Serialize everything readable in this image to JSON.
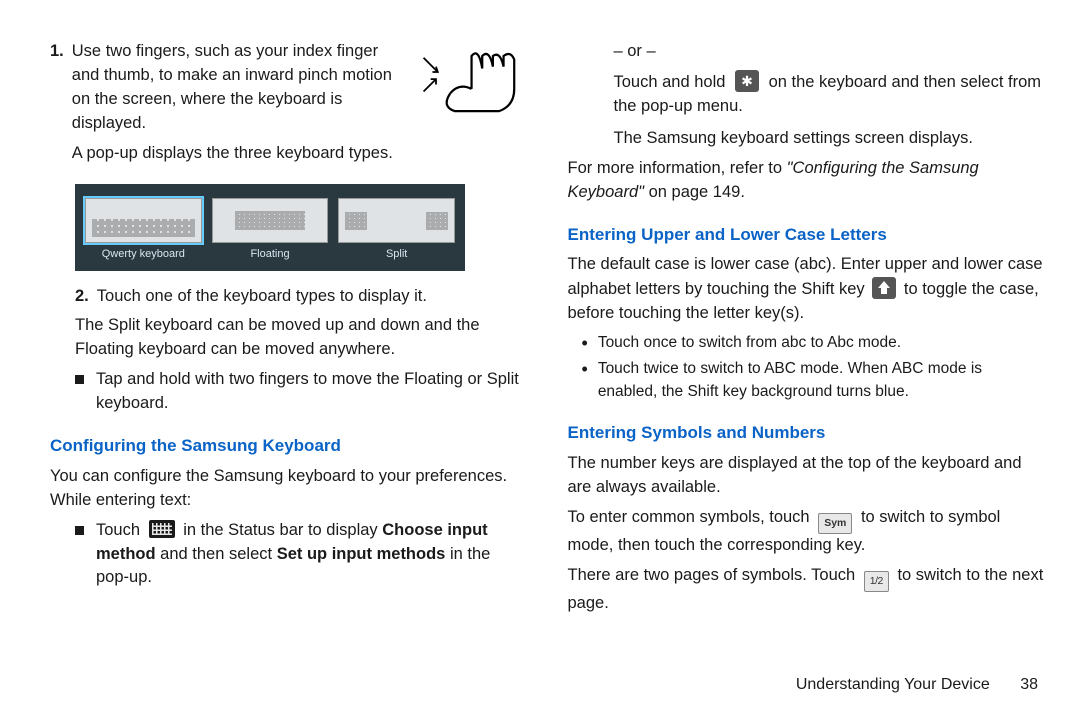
{
  "left": {
    "step1": "Use two fingers, such as your index finger and thumb, to make an inward pinch motion on the screen, where the keyboard is displayed.",
    "step1b": "A pop-up displays the three keyboard types.",
    "kb_labels": [
      "Qwerty keyboard",
      "Floating",
      "Split"
    ],
    "step2": "Touch one of the keyboard types to display it.",
    "step2_note": "The Split keyboard can be moved up and down and the Floating keyboard can be moved anywhere.",
    "step2_sub": "Tap and hold with two fingers to move the Floating or Split keyboard.",
    "h1": "Configuring the Samsung Keyboard",
    "h1_intro": "You can configure the Samsung keyboard to your preferences. While entering text:",
    "cfg_a1": "Touch ",
    "cfg_a2": " in the Status bar to display ",
    "cfg_a3": "Choose input method",
    "cfg_a4": " and then select ",
    "cfg_a5": "Set up input methods",
    "cfg_a6": " in the pop-up."
  },
  "right": {
    "or": "– or –",
    "cfg_b1": "Touch and hold ",
    "cfg_b2": " on the keyboard and then select from the pop-up menu.",
    "result": "The Samsung keyboard settings screen displays.",
    "moreinfo1": "For more information, refer to ",
    "moreinfo2": "\"Configuring the Samsung Keyboard\"",
    "moreinfo3": " on page 149.",
    "h2": "Entering Upper and Lower Case Letters",
    "h2_p1a": "The default case is lower case (abc). Enter upper and lower case alphabet letters by touching the Shift key ",
    "h2_p1b": " to toggle the case, before touching the letter key(s).",
    "h2_b1": "Touch once to switch from abc to Abc mode.",
    "h2_b2": "Touch twice to switch to ABC mode. When ABC mode is enabled, the Shift key background turns blue.",
    "h3": "Entering Symbols and Numbers",
    "h3_p1": "The number keys are displayed at the top of the keyboard and are always available.",
    "h3_p2a": "To enter common symbols, touch ",
    "h3_p2b": " to switch to symbol mode, then touch the corresponding key.",
    "h3_p3a": "There are two pages of symbols. Touch ",
    "h3_p3b": " to switch to the next page.",
    "sym_label": "Sym",
    "pg_label": "1/2"
  },
  "footer": {
    "section": "Understanding Your Device",
    "page": "38"
  }
}
